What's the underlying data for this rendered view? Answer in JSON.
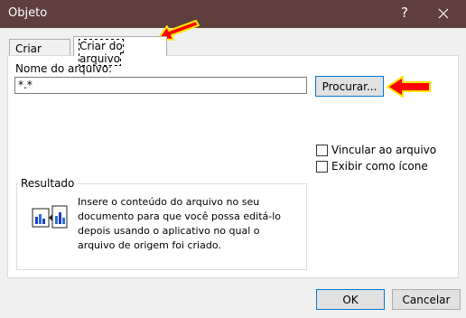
{
  "window": {
    "title": "Objeto",
    "help_glyph": "?",
    "close_icon": "close-icon"
  },
  "tabs": [
    {
      "label": "Criar novo",
      "active": false
    },
    {
      "label": "Criar do arquivo",
      "active": true
    }
  ],
  "file": {
    "label": "Nome do arquivo:",
    "value": "*.*"
  },
  "browse_button": "Procurar...",
  "options": {
    "link_label": "Vincular ao arquivo",
    "link_checked": false,
    "icon_label": "Exibir como ícone",
    "icon_checked": false
  },
  "result": {
    "title": "Resultado",
    "line1": "Insere o conteúdo do arquivo no seu",
    "line2": "documento para que você possa editá-lo",
    "line3": "depois usando o aplicativo no qual o",
    "line4": "arquivo de origem foi criado."
  },
  "footer": {
    "ok_label": "OK",
    "cancel_label": "Cancelar"
  },
  "colors": {
    "titlebar": "#5e3f3d",
    "accent": "#0078d7",
    "annotation_arrow": "#ff0000",
    "annotation_outline": "#ffe600"
  }
}
